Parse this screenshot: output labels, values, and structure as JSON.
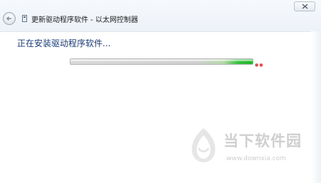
{
  "window": {
    "title": "更新驱动程序软件 - 以太网控制器",
    "back_icon": "back-arrow-icon",
    "app_icon": "device-icon",
    "close_icon": "close-icon"
  },
  "main": {
    "status_text": "正在安装驱动程序软件...",
    "progress_fraction": 1.0
  },
  "watermark": {
    "brand": "当下软件园",
    "url": "www.downxia.com"
  }
}
